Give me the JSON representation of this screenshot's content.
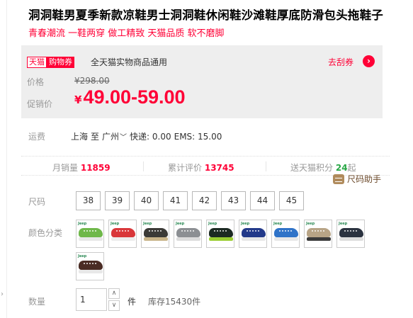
{
  "product": {
    "title": "洞洞鞋男夏季新款凉鞋男士洞洞鞋休闲鞋沙滩鞋厚底防滑包头拖鞋子",
    "subtitle": "青春潮流 一鞋两穿 做工精致 天猫品质 软不磨脚"
  },
  "coupon": {
    "tag_tmall": "天猫",
    "tag_coupon": "购物券",
    "desc": "全天猫实物商品通用",
    "link": "去刮券",
    "arrow_icon": "chevron-right-icon"
  },
  "price": {
    "label": "价格",
    "original": "¥298.00",
    "promo_label": "促销价",
    "currency": "¥",
    "promo": "49.00-59.00"
  },
  "shipping": {
    "label": "运费",
    "from": "上海",
    "to_word": "至",
    "to": "广州",
    "express": "快递: 0.00",
    "ems": "EMS: 15.00"
  },
  "stats": {
    "monthly_sales_label": "月销量",
    "monthly_sales": "11859",
    "reviews_label": "累计评价",
    "reviews": "13745",
    "points_label": "送天猫积分",
    "points": "24",
    "points_suffix": "起"
  },
  "size_helper": "尺码助手",
  "size": {
    "label": "尺码",
    "options": [
      "38",
      "39",
      "40",
      "41",
      "42",
      "43",
      "44",
      "45"
    ]
  },
  "colors": {
    "label": "颜色分类",
    "swatches": [
      {
        "brand": "Jeep",
        "upper": "#6fb84a",
        "sole": "#e8e8e8"
      },
      {
        "brand": "Jeep",
        "upper": "#d9373a",
        "sole": "#ededed"
      },
      {
        "brand": "Jeep",
        "upper": "#3b3a37",
        "sole": "#c9b58a"
      },
      {
        "brand": "Jeep",
        "upper": "#8c8f93",
        "sole": "#dcdcdc"
      },
      {
        "brand": "Jeep",
        "upper": "#1c2a22",
        "sole": "#9acd32"
      },
      {
        "brand": "Jeep",
        "upper": "#233a8a",
        "sole": "#e8e8e8"
      },
      {
        "brand": "Jeep",
        "upper": "#2f73c8",
        "sole": "#e8e8e8"
      },
      {
        "brand": "Jeep",
        "upper": "#b8a486",
        "sole": "#3b3b3b"
      },
      {
        "brand": "Jeep",
        "upper": "#2b3340",
        "sole": "#dedede"
      },
      {
        "brand": "Jeep",
        "upper": "#4a2c24",
        "sole": "#e8e8e8"
      }
    ]
  },
  "quantity": {
    "label": "数量",
    "value": "1",
    "unit": "件",
    "stock": "库存15430件",
    "up_icon": "chevron-up-icon",
    "down_icon": "chevron-down-icon"
  }
}
